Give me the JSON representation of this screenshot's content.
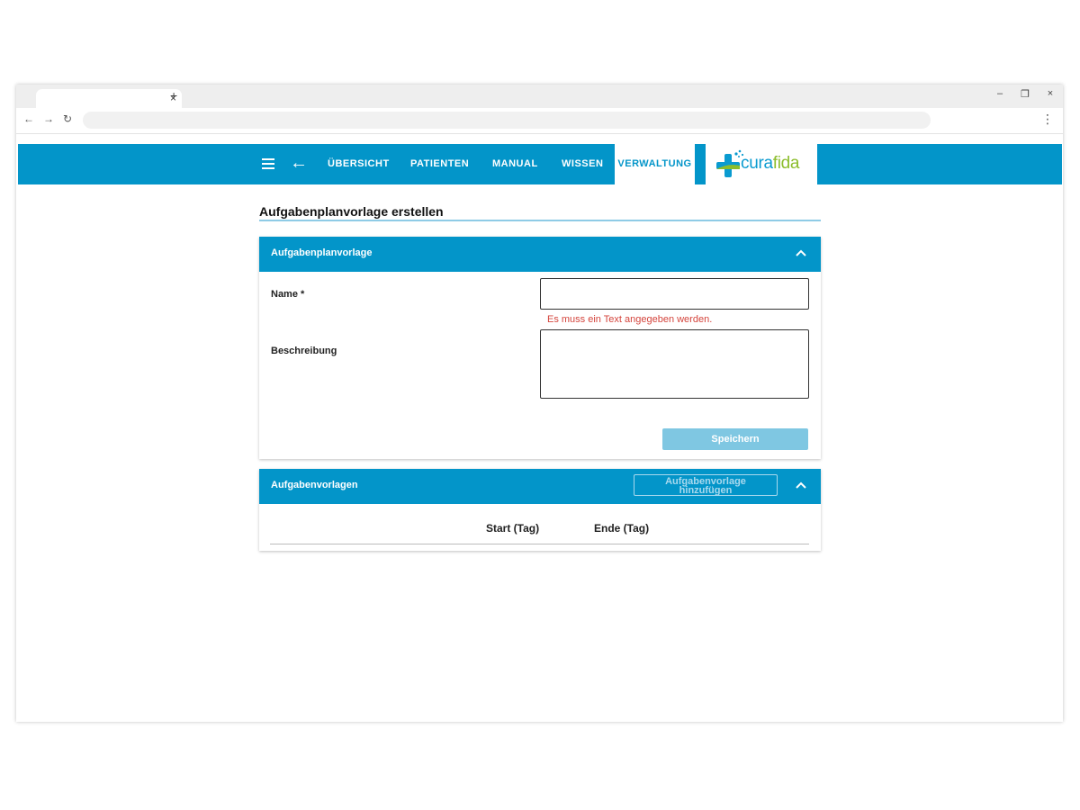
{
  "browser": {
    "tab_close_glyph": "×",
    "new_tab_glyph": "+",
    "window_controls": [
      "–",
      "❐",
      "×"
    ],
    "nav_back_glyph": "←",
    "nav_forward_glyph": "→",
    "reload_glyph": "↻",
    "menu_glyph": "⋮"
  },
  "appbar": {
    "back_glyph": "←",
    "nav": [
      "ÜBERSICHT",
      "PATIENTEN",
      "MANUAL",
      "WISSEN",
      "VERWALTUNG"
    ],
    "active_index": 4,
    "logo": {
      "part1": "cura",
      "part2": "fida"
    },
    "colors": {
      "primary": "#0395c9",
      "logo_green": "#8cbd2c"
    }
  },
  "page": {
    "title": "Aufgabenplanvorlage erstellen"
  },
  "template_panel": {
    "title": "Aufgabenplanvorlage",
    "name_label": "Name *",
    "name_value": "",
    "name_error": "Es muss ein Text angegeben werden.",
    "description_label": "Beschreibung",
    "description_value": "",
    "save_label": "Speichern"
  },
  "tasks_panel": {
    "title": "Aufgabenvorlagen",
    "add_label_line1": "Aufgabenvorlage",
    "add_label_line2": "hinzufügen",
    "columns": [
      "Start (Tag)",
      "Ende (Tag)"
    ]
  }
}
